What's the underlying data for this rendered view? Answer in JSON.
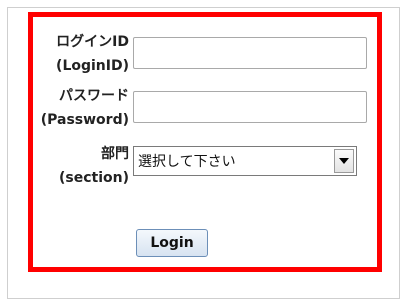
{
  "form": {
    "login_id": {
      "label_line1": "ログインID",
      "label_line2": "(LoginID)",
      "value": "",
      "placeholder": ""
    },
    "password": {
      "label_line1": "パスワード",
      "label_line2": "(Password)",
      "value": "",
      "placeholder": ""
    },
    "section": {
      "label_line1": "部門",
      "label_line2": "(section)",
      "selected": "選択して下さい"
    },
    "login_button_label": "Login"
  },
  "colors": {
    "highlight_border": "#ff0000",
    "button_border": "#6c8fb8"
  },
  "icons": {
    "dropdown": "chevron-down-icon"
  }
}
